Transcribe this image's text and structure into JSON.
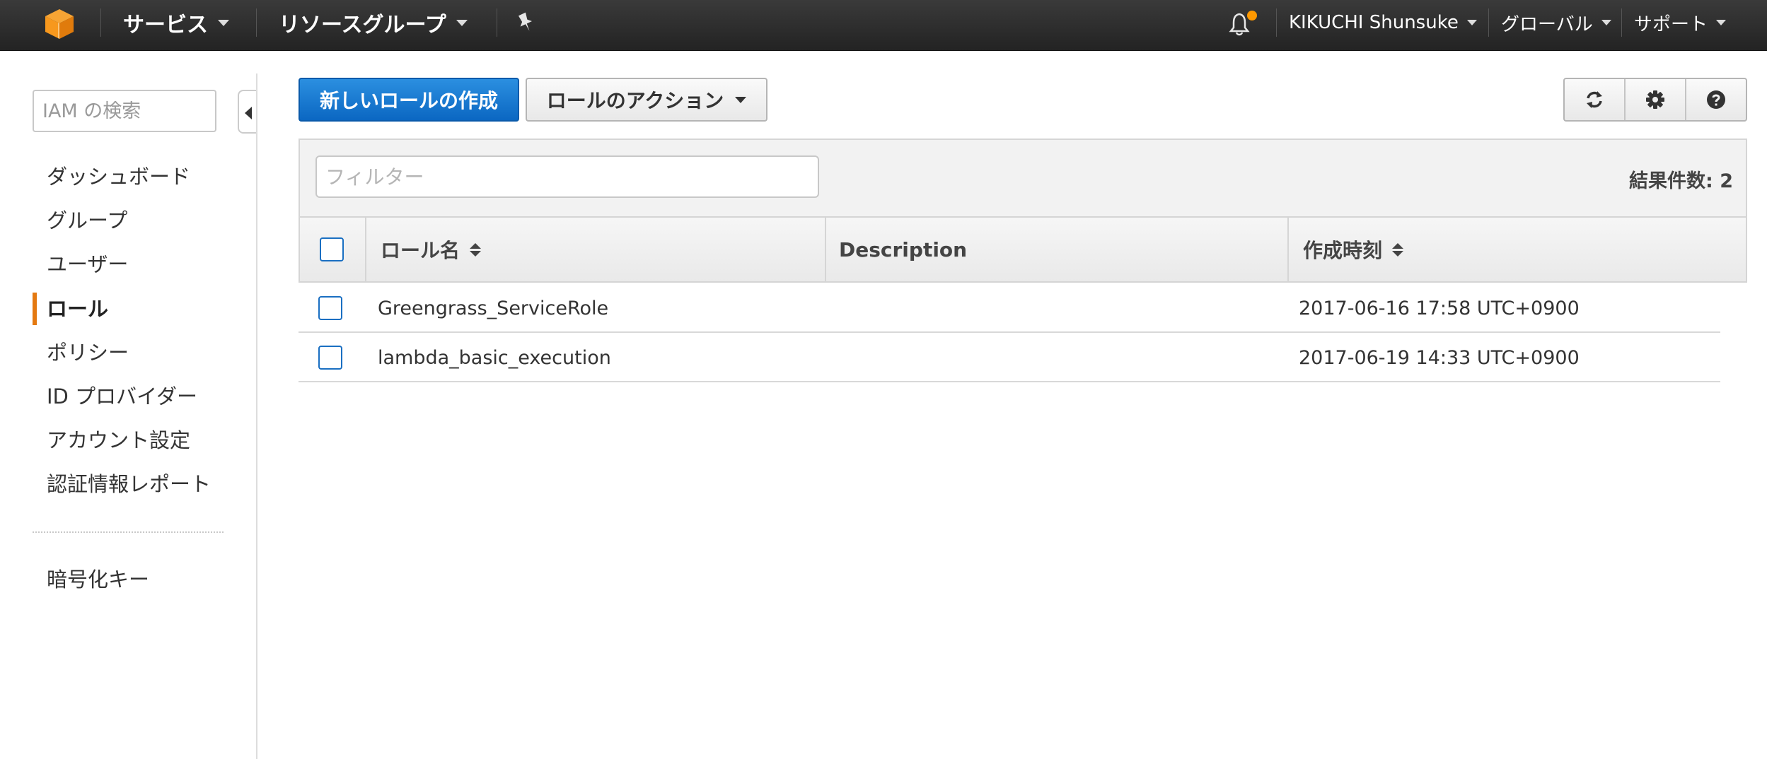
{
  "topbar": {
    "services": "サービス",
    "resource_groups": "リソースグループ",
    "user": "KIKUCHI Shunsuke",
    "region": "グローバル",
    "support": "サポート",
    "notification_dot_color": "#f90"
  },
  "sidebar": {
    "search_placeholder": "IAM の検索",
    "items": [
      {
        "label": "ダッシュボード"
      },
      {
        "label": "グループ"
      },
      {
        "label": "ユーザー"
      },
      {
        "label": "ロール",
        "active": true
      },
      {
        "label": "ポリシー"
      },
      {
        "label": "ID プロバイダー"
      },
      {
        "label": "アカウント設定"
      },
      {
        "label": "認証情報レポート"
      }
    ],
    "footer_item": "暗号化キー"
  },
  "toolbar": {
    "create_role": "新しいロールの作成",
    "role_actions": "ロールのアクション"
  },
  "table": {
    "filter_placeholder": "フィルター",
    "result_count": "結果件数: 2",
    "columns": {
      "role_name": "ロール名",
      "description": "Description",
      "created": "作成時刻"
    },
    "rows": [
      {
        "name": "Greengrass_ServiceRole",
        "description": "",
        "created": "2017-06-16 17:58 UTC+0900"
      },
      {
        "name": "lambda_basic_execution",
        "description": "",
        "created": "2017-06-19 14:33 UTC+0900"
      }
    ]
  },
  "colors": {
    "accent_blue": "#0b67c2",
    "active_marker": "#e47911",
    "logo_orange": "#f7981d"
  }
}
